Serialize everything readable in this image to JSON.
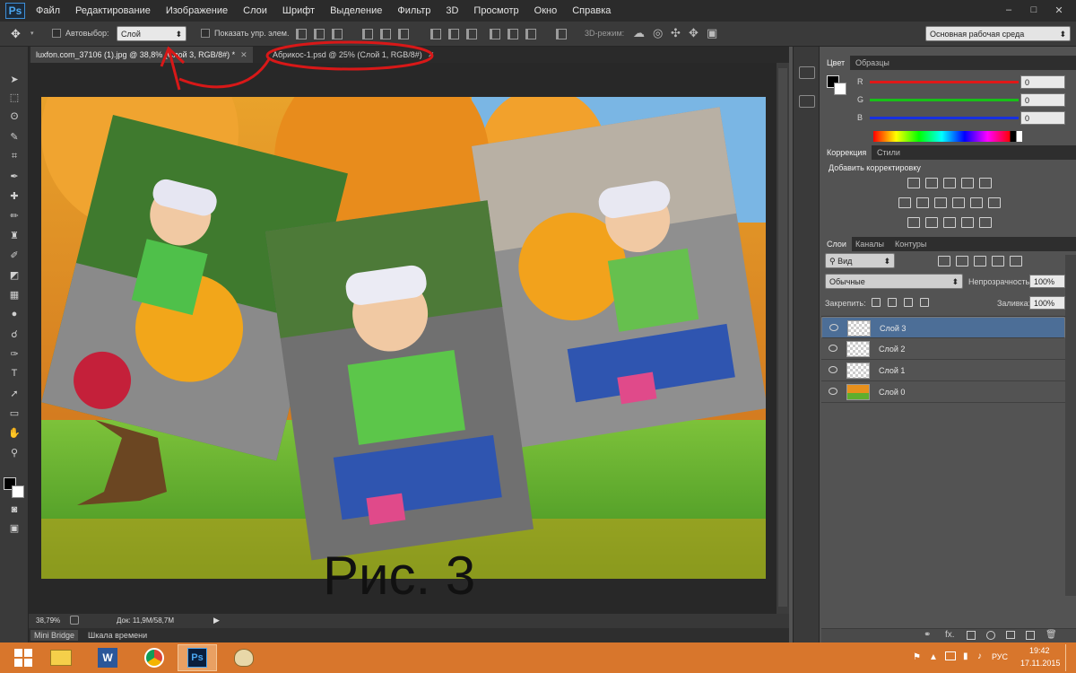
{
  "app": {
    "logo": "Ps"
  },
  "menu": [
    "Файл",
    "Редактирование",
    "Изображение",
    "Слои",
    "Шрифт",
    "Выделение",
    "Фильтр",
    "3D",
    "Просмотр",
    "Окно",
    "Справка"
  ],
  "window_controls": [
    "–",
    "□",
    "✕"
  ],
  "options": {
    "autoselect_label": "Автовыбор:",
    "autoselect_value": "Слой",
    "show_controls_label": "Показать упр. элем.",
    "mode_3d_label": "3D-режим:",
    "workspace_value": "Основная рабочая среда"
  },
  "doc_tabs": [
    {
      "label": "luxfon.com_37106 (1).jpg @ 38,8% (Слой 3, RGB/8#) *",
      "active": true
    },
    {
      "label": "Абрикос-1.psd @ 25% (Слой 1, RGB/8#)",
      "active": false
    }
  ],
  "canvas_caption": "Рис. 3",
  "status": {
    "zoom": "38,79%",
    "doc": "Док: 11,9M/58,7M"
  },
  "bottom_tabs": [
    "Mini Bridge",
    "Шкала времени"
  ],
  "color_panel": {
    "tabs": [
      "Цвет",
      "Образцы"
    ],
    "channels": [
      {
        "name": "R",
        "value": "0",
        "color": "#e01818"
      },
      {
        "name": "G",
        "value": "0",
        "color": "#18c018"
      },
      {
        "name": "B",
        "value": "0",
        "color": "#1830e0"
      }
    ]
  },
  "adjust_panel": {
    "tabs": [
      "Коррекция",
      "Стили"
    ],
    "title": "Добавить корректировку"
  },
  "layers_panel": {
    "tabs": [
      "Слои",
      "Каналы",
      "Контуры"
    ],
    "filter_value": "Вид",
    "blend_value": "Обычные",
    "opacity_label": "Непрозрачность:",
    "opacity_value": "100%",
    "lock_label": "Закрепить:",
    "fill_label": "Заливка:",
    "fill_value": "100%",
    "layers": [
      {
        "name": "Слой 3",
        "selected": true
      },
      {
        "name": "Слой 2",
        "selected": false
      },
      {
        "name": "Слой 1",
        "selected": false
      },
      {
        "name": "Слой 0",
        "selected": false
      }
    ],
    "footer_fx": "fx."
  },
  "taskbar": {
    "lang": "РУС",
    "time": "19:42",
    "date": "17.11.2015"
  },
  "annotation_color": "#d81818"
}
